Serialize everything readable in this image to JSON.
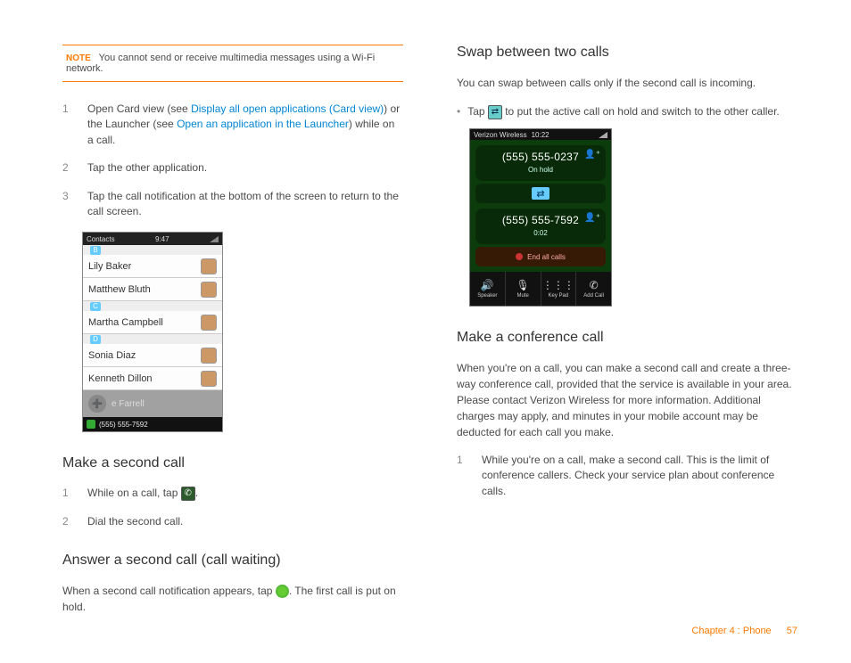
{
  "note": {
    "label": "NOTE",
    "text": "You cannot send or receive multimedia messages using a Wi-Fi network."
  },
  "left": {
    "steps_a": [
      {
        "n": "1",
        "pre": "Open Card view (see ",
        "link1": "Display all open applications (Card view)",
        "mid": ") or the Launcher (see ",
        "link2": "Open an application in the Launcher",
        "post": ") while on a call."
      },
      {
        "n": "2",
        "text": "Tap the other application."
      },
      {
        "n": "3",
        "text": "Tap the call notification at the bottom of the screen to return to the call screen."
      }
    ],
    "fig_contacts": {
      "header_left": "Contacts",
      "header_time": "9:47",
      "letters": [
        "B",
        "C",
        "D"
      ],
      "rows": [
        "Lily Baker",
        "Matthew Bluth",
        "Martha Campbell",
        "Sonia Diaz",
        "Kenneth Dillon"
      ],
      "dim_name": "e Farrell",
      "footer_number": "(555) 555-7592"
    },
    "sec2_title": "Make a second call",
    "sec2_steps": [
      {
        "n": "1",
        "pre": "While on a call, tap ",
        "post": "."
      },
      {
        "n": "2",
        "text": "Dial the second call."
      }
    ],
    "sec3_title": "Answer a second call (call waiting)",
    "sec3_para_pre": "When a second call notification appears, tap ",
    "sec3_para_post": ". The first call is put on hold."
  },
  "right": {
    "sec1_title": "Swap between two calls",
    "sec1_para": "You can swap between calls only if the second call is incoming.",
    "sec1_bullet_pre": "Tap ",
    "sec1_bullet_post": " to put the active call on hold and switch to the other caller.",
    "fig_call": {
      "carrier": "Verizon Wireless",
      "time": "10:22",
      "call1_num": "(555) 555-0237",
      "call1_status": "On hold",
      "call2_num": "(555) 555-7592",
      "call2_status": "0:02",
      "end_label": "End all calls",
      "buttons": [
        {
          "glyph": "🔊",
          "label": "Speaker"
        },
        {
          "glyph": "🎙",
          "label": "Mute"
        },
        {
          "glyph": "⋮⋮⋮",
          "label": "Key Pad"
        },
        {
          "glyph": "✆",
          "label": "Add Call"
        }
      ]
    },
    "sec2_title": "Make a conference call",
    "sec2_para": "When you're on a call, you can make a second call and create a three-way conference call, provided that the service is available in your area. Please contact Verizon Wireless for more information. Additional charges may apply, and minutes in your mobile account may be deducted for each call you make.",
    "sec2_steps": [
      {
        "n": "1",
        "text": "While you're on a call, make a second call. This is the limit of conference callers. Check your service plan about conference calls."
      }
    ]
  },
  "footer": {
    "chapter": "Chapter 4 : Phone",
    "page": "57"
  }
}
